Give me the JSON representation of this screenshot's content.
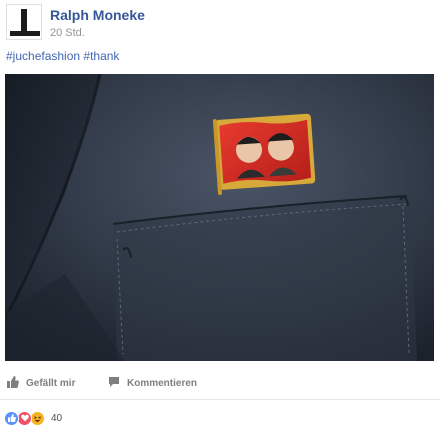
{
  "post": {
    "author": "Ralph Moneke",
    "timestamp": "20 Std.",
    "hashtags": [
      "#juchefashion",
      "#thank"
    ]
  },
  "actions": {
    "like_label": "Gefällt mir",
    "comment_label": "Kommentieren"
  },
  "reactions": {
    "types": [
      "like",
      "love",
      "haha"
    ],
    "count": "40"
  },
  "icons": {
    "like": "thumbs-up-icon",
    "comment": "speech-bubble-icon"
  },
  "colors": {
    "link": "#365899",
    "hashtag": "#4267b2",
    "like_reaction": "#5890ff",
    "love_reaction": "#f25268",
    "haha_reaction": "#f7b125"
  }
}
